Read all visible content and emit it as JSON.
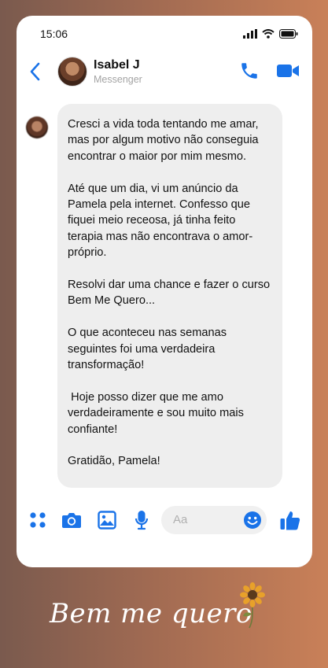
{
  "status_bar": {
    "time": "15:06"
  },
  "header": {
    "contact_name": "Isabel J",
    "contact_subtitle": "Messenger"
  },
  "message": {
    "paragraphs": [
      "Cresci a vida toda tentando me amar, mas por algum motivo não conseguia encontrar o maior por mim mesmo.",
      "Até que um dia, vi um anúncio da Pamela pela internet. Confesso que fiquei meio receosa, já tinha feito terapia mas não encontrava o amor-próprio.",
      "Resolvi dar uma chance e fazer o curso Bem Me Quero...",
      "O que aconteceu nas semanas seguintes foi uma verdadeira transformação!",
      " Hoje posso dizer que me amo verdadeiramente e sou muito mais confiante!",
      "Gratidão, Pamela!"
    ]
  },
  "composer": {
    "placeholder": "Aa"
  },
  "brand": {
    "logo_text": "Bem me quero"
  },
  "colors": {
    "accent": "#1a73e8",
    "bubble": "#eeeeee"
  }
}
